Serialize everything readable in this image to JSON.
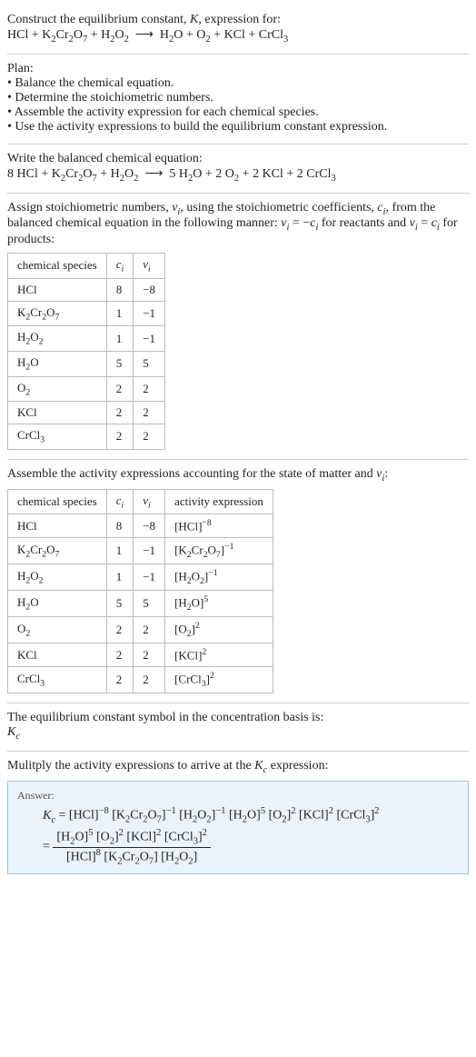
{
  "intro": {
    "title_html": "Construct the equilibrium constant, <i>K</i>, expression for:",
    "equation_html": "HCl + K<sub>2</sub>Cr<sub>2</sub>O<sub>7</sub> + H<sub>2</sub>O<sub>2</sub> &nbsp;⟶&nbsp; H<sub>2</sub>O + O<sub>2</sub> + KCl + CrCl<sub>3</sub>"
  },
  "plan": {
    "heading": "Plan:",
    "items": [
      "Balance the chemical equation.",
      "Determine the stoichiometric numbers.",
      "Assemble the activity expression for each chemical species.",
      "Use the activity expressions to build the equilibrium constant expression."
    ]
  },
  "balanced": {
    "heading": "Write the balanced chemical equation:",
    "equation_html": "8 HCl + K<sub>2</sub>Cr<sub>2</sub>O<sub>7</sub> + H<sub>2</sub>O<sub>2</sub> &nbsp;⟶&nbsp; 5 H<sub>2</sub>O + 2 O<sub>2</sub> + 2 KCl + 2 CrCl<sub>3</sub>"
  },
  "assign": {
    "text_html": "Assign stoichiometric numbers, <i>ν<sub>i</sub></i>, using the stoichiometric coefficients, <i>c<sub>i</sub></i>, from the balanced chemical equation in the following manner: <i>ν<sub>i</sub></i> = −<i>c<sub>i</sub></i> for reactants and <i>ν<sub>i</sub></i> = <i>c<sub>i</sub></i> for products:",
    "headers": {
      "sp": "chemical species",
      "ci_html": "<i>c<sub>i</sub></i>",
      "vi_html": "<i>ν<sub>i</sub></i>"
    },
    "rows": [
      {
        "sp_html": "HCl",
        "ci": "8",
        "vi": "−8"
      },
      {
        "sp_html": "K<sub>2</sub>Cr<sub>2</sub>O<sub>7</sub>",
        "ci": "1",
        "vi": "−1"
      },
      {
        "sp_html": "H<sub>2</sub>O<sub>2</sub>",
        "ci": "1",
        "vi": "−1"
      },
      {
        "sp_html": "H<sub>2</sub>O",
        "ci": "5",
        "vi": "5"
      },
      {
        "sp_html": "O<sub>2</sub>",
        "ci": "2",
        "vi": "2"
      },
      {
        "sp_html": "KCl",
        "ci": "2",
        "vi": "2"
      },
      {
        "sp_html": "CrCl<sub>3</sub>",
        "ci": "2",
        "vi": "2"
      }
    ]
  },
  "activity": {
    "text_html": "Assemble the activity expressions accounting for the state of matter and <i>ν<sub>i</sub></i>:",
    "headers": {
      "sp": "chemical species",
      "ci_html": "<i>c<sub>i</sub></i>",
      "vi_html": "<i>ν<sub>i</sub></i>",
      "ae": "activity expression"
    },
    "rows": [
      {
        "sp_html": "HCl",
        "ci": "8",
        "vi": "−8",
        "ae_html": "[HCl]<sup>−8</sup>"
      },
      {
        "sp_html": "K<sub>2</sub>Cr<sub>2</sub>O<sub>7</sub>",
        "ci": "1",
        "vi": "−1",
        "ae_html": "[K<sub>2</sub>Cr<sub>2</sub>O<sub>7</sub>]<sup>−1</sup>"
      },
      {
        "sp_html": "H<sub>2</sub>O<sub>2</sub>",
        "ci": "1",
        "vi": "−1",
        "ae_html": "[H<sub>2</sub>O<sub>2</sub>]<sup>−1</sup>"
      },
      {
        "sp_html": "H<sub>2</sub>O",
        "ci": "5",
        "vi": "5",
        "ae_html": "[H<sub>2</sub>O]<sup>5</sup>"
      },
      {
        "sp_html": "O<sub>2</sub>",
        "ci": "2",
        "vi": "2",
        "ae_html": "[O<sub>2</sub>]<sup>2</sup>"
      },
      {
        "sp_html": "KCl",
        "ci": "2",
        "vi": "2",
        "ae_html": "[KCl]<sup>2</sup>"
      },
      {
        "sp_html": "CrCl<sub>3</sub>",
        "ci": "2",
        "vi": "2",
        "ae_html": "[CrCl<sub>3</sub>]<sup>2</sup>"
      }
    ]
  },
  "symbol": {
    "text": "The equilibrium constant symbol in the concentration basis is:",
    "kc_html": "<i>K<sub>c</sub></i>"
  },
  "multiply": {
    "text_html": "Mulitply the activity expressions to arrive at the <i>K<sub>c</sub></i> expression:"
  },
  "answer": {
    "label": "Answer:",
    "line1_html": "<i>K<sub>c</sub></i> = [HCl]<sup>−8</sup> [K<sub>2</sub>Cr<sub>2</sub>O<sub>7</sub>]<sup>−1</sup> [H<sub>2</sub>O<sub>2</sub>]<sup>−1</sup> [H<sub>2</sub>O]<sup>5</sup> [O<sub>2</sub>]<sup>2</sup> [KCl]<sup>2</sup> [CrCl<sub>3</sub>]<sup>2</sup>",
    "frac_num_html": "[H<sub>2</sub>O]<sup>5</sup> [O<sub>2</sub>]<sup>2</sup> [KCl]<sup>2</sup> [CrCl<sub>3</sub>]<sup>2</sup>",
    "frac_den_html": "[HCl]<sup>8</sup> [K<sub>2</sub>Cr<sub>2</sub>O<sub>7</sub>] [H<sub>2</sub>O<sub>2</sub>]"
  }
}
